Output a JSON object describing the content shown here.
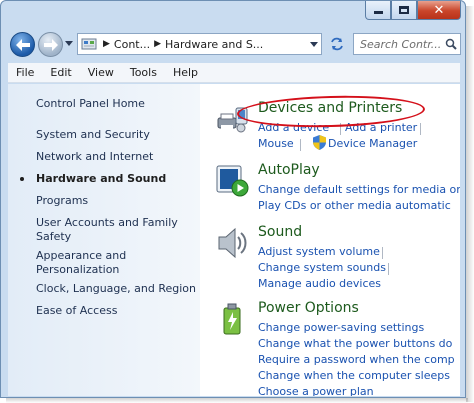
{
  "address": {
    "segments": [
      "Cont...",
      "Hardware and S..."
    ]
  },
  "search": {
    "placeholder": "Search Contr..."
  },
  "menu": [
    "File",
    "Edit",
    "View",
    "Tools",
    "Help"
  ],
  "sidebar": {
    "home": "Control Panel Home",
    "items": [
      "System and Security",
      "Network and Internet",
      "Hardware and Sound",
      "Programs",
      "User Accounts and Family Safety",
      "Appearance and Personalization",
      "Clock, Language, and Region",
      "Ease of Access"
    ],
    "current_index": 2
  },
  "categories": {
    "devices": {
      "title": "Devices and Printers",
      "links": [
        "Add a device",
        "Add a printer",
        "Mouse",
        "Device Manager"
      ]
    },
    "autoplay": {
      "title": "AutoPlay",
      "links": [
        "Change default settings for media or",
        "Play CDs or other media automatic"
      ]
    },
    "sound": {
      "title": "Sound",
      "links": [
        "Adjust system volume",
        "Change system sounds",
        "Manage audio devices"
      ]
    },
    "power": {
      "title": "Power Options",
      "links": [
        "Change power-saving settings",
        "Change what the power buttons do",
        "Require a password when the comp",
        "Change when the computer sleeps",
        "Choose a power plan"
      ]
    }
  },
  "colors": {
    "link": "#1a52b0",
    "category_title": "#1d5a1d",
    "highlight": "#d4101a"
  }
}
